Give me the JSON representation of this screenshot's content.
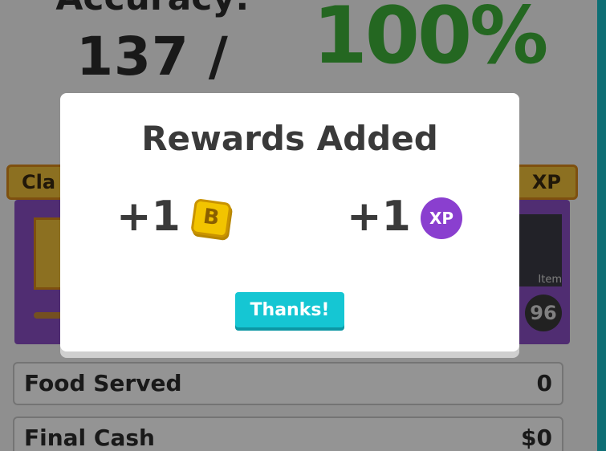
{
  "results": {
    "accuracy_label": "Accuracy:",
    "accuracy_count": "137 / 137",
    "accuracy_percent": "100%"
  },
  "cards": {
    "left_header": "Cla",
    "right_header": "XP",
    "item_label": "Item",
    "item_value": "96"
  },
  "stats": [
    {
      "label": "Food Served",
      "value": "0"
    },
    {
      "label": "Final Cash",
      "value": "$0"
    }
  ],
  "modal": {
    "title": "Rewards Added",
    "rewards": [
      {
        "amount": "+1",
        "icon": "blook-token-icon",
        "icon_letter": "B"
      },
      {
        "amount": "+1",
        "icon": "xp-icon",
        "icon_text": "XP"
      }
    ],
    "button_label": "Thanks!"
  },
  "colors": {
    "accent": "#15c6d3",
    "percent_green": "#3fb23a",
    "xp_purple": "#8a3fcf",
    "token_gold": "#f2c400"
  }
}
